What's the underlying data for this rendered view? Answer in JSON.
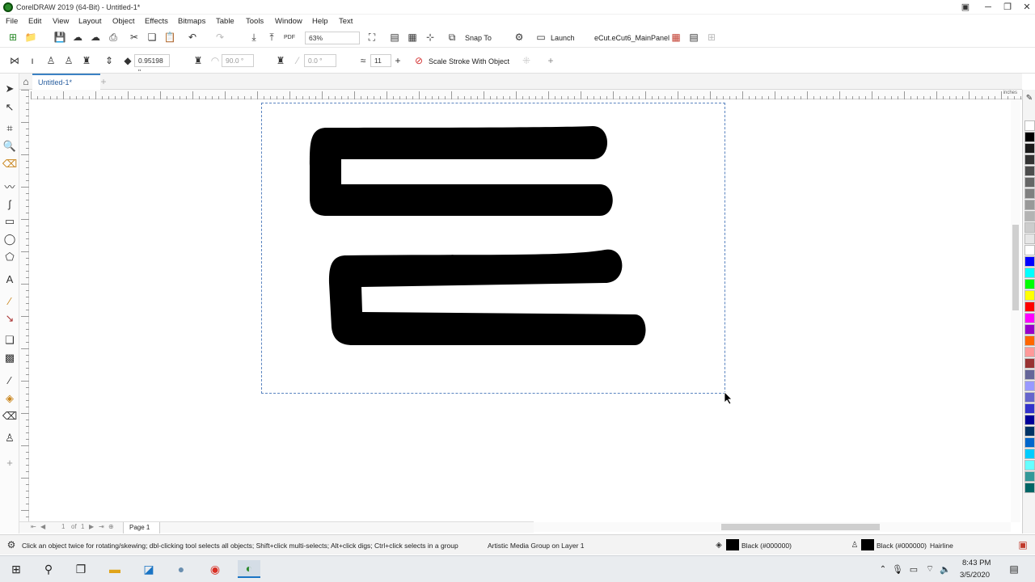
{
  "titlebar": {
    "title": "CorelDRAW 2019 (64-Bit) - Untitled-1*"
  },
  "menubar": {
    "items": [
      "File",
      "Edit",
      "View",
      "Layout",
      "Object",
      "Effects",
      "Bitmaps",
      "Table",
      "Tools",
      "Window",
      "Help",
      "Text"
    ]
  },
  "toolbar1": {
    "zoom": "63%",
    "snap_to": "Snap To",
    "launch": "Launch",
    "ecut": "eCut.eCut6_MainPanel"
  },
  "toolbar2": {
    "width_value": "0.95198 \"",
    "angle_value": "90.0 °",
    "rotation_value": "0.0 °",
    "smooth_value": "11",
    "scale_stroke": "Scale Stroke With Object"
  },
  "tabs": [
    {
      "label": "Untitled-1*"
    }
  ],
  "ruler": {
    "unit": "inches",
    "ticks": [
      "13",
      "13",
      "14",
      "15",
      "16",
      "17",
      "18",
      "19",
      "20",
      "21",
      "22",
      "13",
      "23",
      "24",
      "25",
      "26",
      "27",
      "28",
      "29",
      "30",
      "31"
    ]
  },
  "pagenav": {
    "current": "1",
    "of": "of",
    "total": "1",
    "page_label": "Page 1"
  },
  "status": {
    "hint": "Click an object twice for rotating/skewing; dbl-clicking tool selects all objects; Shift+click multi-selects; Alt+click digs; Ctrl+click selects in a group",
    "object": "Artistic Media Group on Layer 1",
    "fill": "Black (#000000)",
    "outline": "Black (#000000)",
    "outline_width": "Hairline"
  },
  "taskbar": {
    "time": "8:43 PM",
    "date": "3/5/2020"
  },
  "palette": [
    "#ffffff",
    "#000000",
    "#1a1a1a",
    "#333333",
    "#4d4d4d",
    "#666666",
    "#808080",
    "#999999",
    "#b3b3b3",
    "#cccccc",
    "#e6e6e6",
    "#ffffff",
    "#0000ff",
    "#00ffff",
    "#00ff00",
    "#ffff00",
    "#ff0000",
    "#ff00ff",
    "#9900cc",
    "#ff6600",
    "#ff9999",
    "#993333",
    "#666699",
    "#9999ff",
    "#6666cc",
    "#3333cc",
    "#000099",
    "#003366",
    "#0066cc",
    "#00ccff",
    "#66ffff",
    "#339999",
    "#006666"
  ]
}
